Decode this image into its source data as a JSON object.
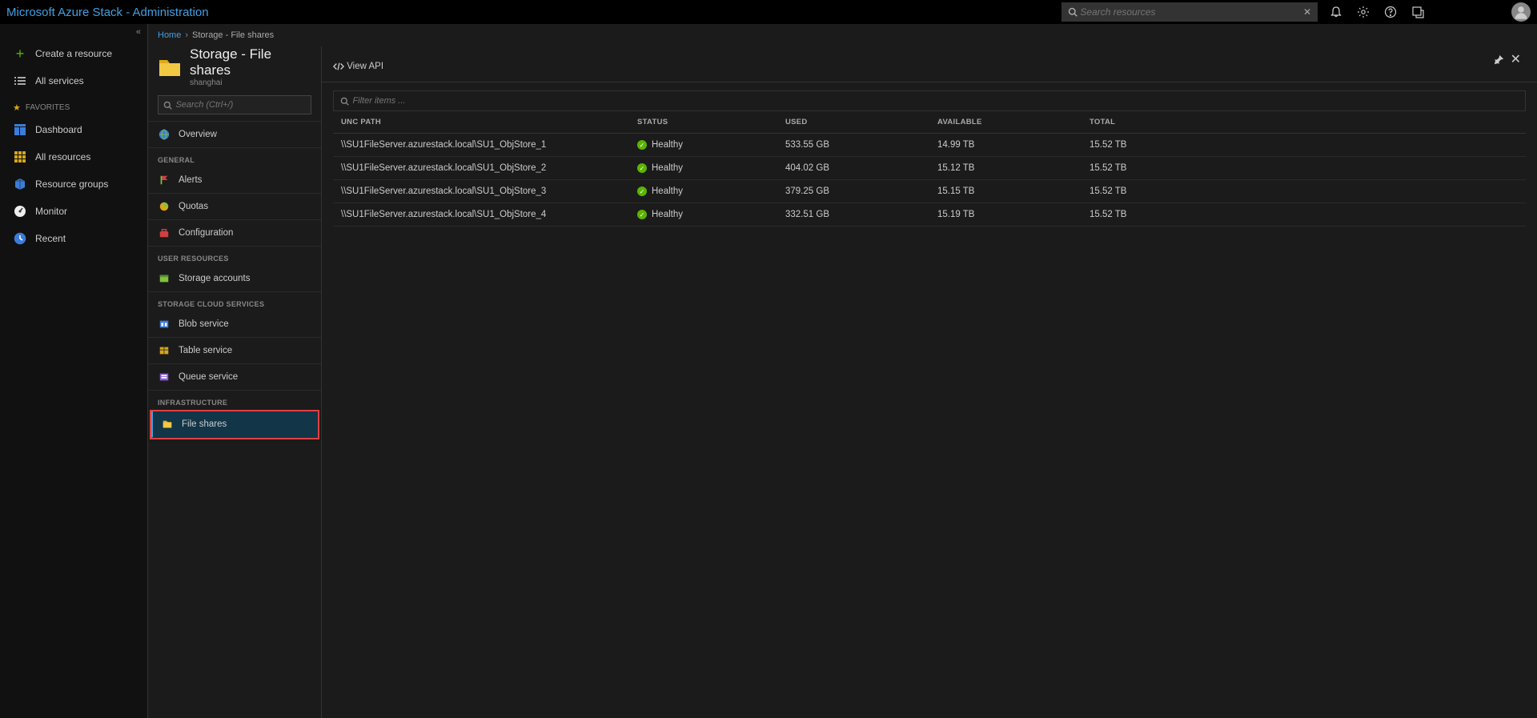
{
  "topbar": {
    "title": "Microsoft Azure Stack - Administration",
    "search_placeholder": "Search resources"
  },
  "leftnav": {
    "create": "Create a resource",
    "all_services": "All services",
    "favorites_label": "FAVORITES",
    "items": [
      {
        "label": "Dashboard"
      },
      {
        "label": "All resources"
      },
      {
        "label": "Resource groups"
      },
      {
        "label": "Monitor"
      },
      {
        "label": "Recent"
      }
    ]
  },
  "breadcrumb": {
    "home": "Home",
    "current": "Storage - File shares"
  },
  "resource": {
    "title": "Storage - File shares",
    "subtitle": "shanghai",
    "search_placeholder": "Search (Ctrl+/)"
  },
  "menu": {
    "overview": "Overview",
    "sections": {
      "general": "GENERAL",
      "user_resources": "USER RESOURCES",
      "storage_cloud": "STORAGE CLOUD SERVICES",
      "infrastructure": "INFRASTRUCTURE"
    },
    "items": {
      "alerts": "Alerts",
      "quotas": "Quotas",
      "configuration": "Configuration",
      "storage_accounts": "Storage accounts",
      "blob_service": "Blob service",
      "table_service": "Table service",
      "queue_service": "Queue service",
      "file_shares": "File shares"
    }
  },
  "toolbar": {
    "view_api": "View API"
  },
  "filter": {
    "placeholder": "Filter items ..."
  },
  "table": {
    "headers": {
      "unc": "UNC PATH",
      "status": "STATUS",
      "used": "USED",
      "available": "AVAILABLE",
      "total": "TOTAL"
    },
    "rows": [
      {
        "unc": "\\\\SU1FileServer.azurestack.local\\SU1_ObjStore_1",
        "status": "Healthy",
        "used": "533.55 GB",
        "available": "14.99 TB",
        "total": "15.52 TB"
      },
      {
        "unc": "\\\\SU1FileServer.azurestack.local\\SU1_ObjStore_2",
        "status": "Healthy",
        "used": "404.02 GB",
        "available": "15.12 TB",
        "total": "15.52 TB"
      },
      {
        "unc": "\\\\SU1FileServer.azurestack.local\\SU1_ObjStore_3",
        "status": "Healthy",
        "used": "379.25 GB",
        "available": "15.15 TB",
        "total": "15.52 TB"
      },
      {
        "unc": "\\\\SU1FileServer.azurestack.local\\SU1_ObjStore_4",
        "status": "Healthy",
        "used": "332.51 GB",
        "available": "15.19 TB",
        "total": "15.52 TB"
      }
    ]
  }
}
